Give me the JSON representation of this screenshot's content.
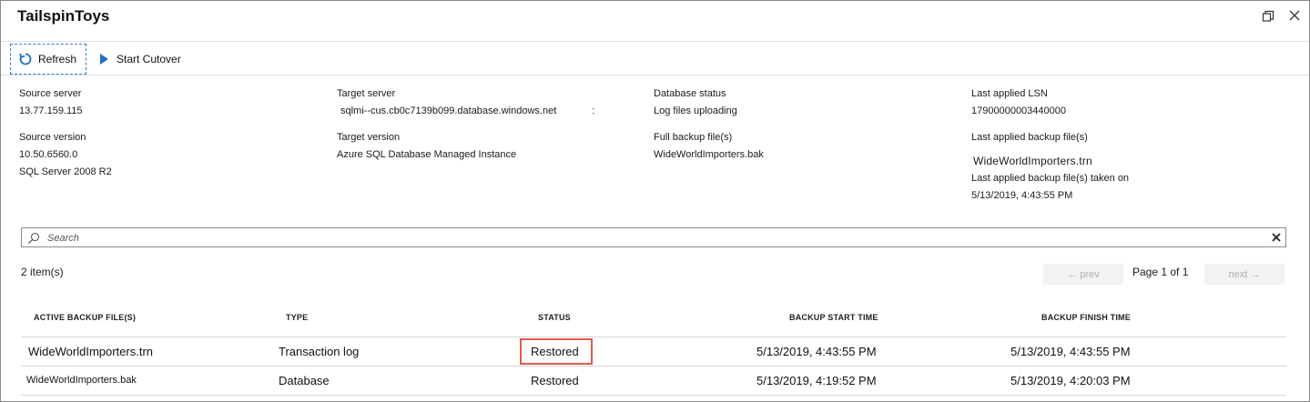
{
  "window": {
    "title": "TailspinToys"
  },
  "toolbar": {
    "refresh_label": "Refresh",
    "cutover_label": "Start Cutover"
  },
  "info": {
    "source_server_label": "Source server",
    "source_server_value": "13.77.159.115",
    "source_version_label": "Source version",
    "source_version_value": "10.50.6560.0",
    "source_version_product": "SQL Server 2008 R2",
    "target_server_label": "Target server",
    "target_server_value": "sqlmi--cus.cb0c7139b099.database.windows.net",
    "target_server_suffix": ":",
    "target_version_label": "Target version",
    "target_version_value": "Azure SQL Database Managed Instance",
    "db_status_label": "Database status",
    "db_status_value": "Log files uploading",
    "full_backup_label": "Full backup file(s)",
    "full_backup_value": "WideWorldImporters.bak",
    "last_lsn_label": "Last applied LSN",
    "last_lsn_value": "17900000003440000",
    "last_backup_label": "Last applied backup file(s)",
    "last_backup_value": "WideWorldImporters.trn",
    "last_backup_taken_label": "Last applied backup file(s) taken on",
    "last_backup_taken_value": "5/13/2019, 4:43:55 PM"
  },
  "search": {
    "placeholder": "Search"
  },
  "list": {
    "count": "2 item(s)",
    "prev_label": "← prev",
    "next_label": "next →",
    "page_text": "Page 1 of 1"
  },
  "table": {
    "headers": [
      "ACTIVE BACKUP FILE(S)",
      "TYPE",
      "STATUS",
      "BACKUP START TIME",
      "BACKUP FINISH TIME"
    ],
    "rows": [
      {
        "file": "WideWorldImporters.trn",
        "type": "Transaction log",
        "status": "Restored",
        "start": "5/13/2019, 4:43:55 PM",
        "finish": "5/13/2019, 4:43:55 PM"
      },
      {
        "file": "WideWorldImporters.bak",
        "type": "Database",
        "status": "Restored",
        "start": "5/13/2019, 4:19:52 PM",
        "finish": "5/13/2019, 4:20:03 PM"
      }
    ]
  },
  "colors": {
    "accent": "#1f6fc5",
    "highlight": "#e05a4b"
  },
  "icons": {
    "refresh": "refresh-icon",
    "play": "play-icon",
    "search": "search-icon",
    "clear": "close-icon",
    "restore": "restore-window-icon",
    "close": "close-window-icon"
  }
}
